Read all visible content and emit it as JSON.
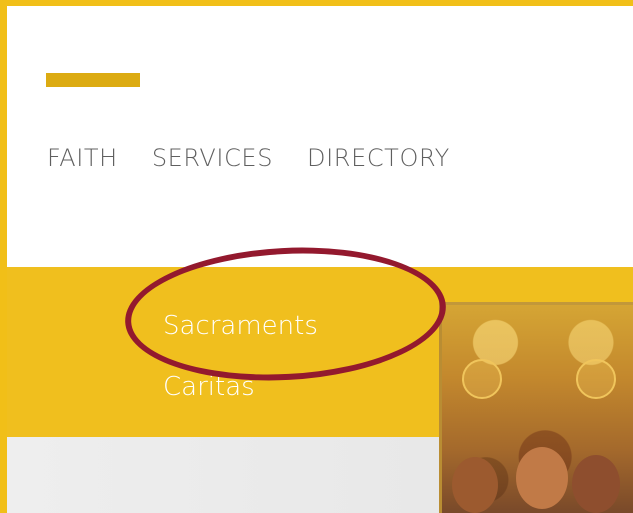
{
  "nav": {
    "items": [
      {
        "label": "FAITH"
      },
      {
        "label": "SERVICES"
      },
      {
        "label": "DIRECTORY"
      }
    ]
  },
  "dropdown": {
    "items": [
      {
        "label": "Sacraments",
        "highlighted": true
      },
      {
        "label": "Caritas"
      }
    ]
  },
  "colors": {
    "frame": "#f1bf18",
    "accent_bar": "#dcab12",
    "dropdown_bg": "#f0bf1e",
    "nav_text": "#5f5f5f",
    "dropdown_text": "#ffffff",
    "highlight_ring": "#93192e"
  }
}
